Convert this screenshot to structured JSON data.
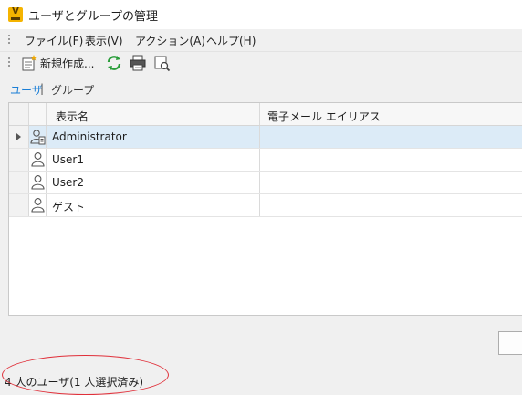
{
  "window": {
    "title": "ユーザとグループの管理",
    "app_icon_letter": "V"
  },
  "menu": {
    "items": [
      {
        "label": "ファイル(F)"
      },
      {
        "label": "表示(V)"
      },
      {
        "label": "アクション(A)"
      },
      {
        "label": "ヘルプ(H)"
      }
    ]
  },
  "toolbar": {
    "new_label": "新規作成...",
    "icons": [
      "new-document-icon",
      "refresh-icon",
      "print-icon",
      "print-preview-icon"
    ]
  },
  "tabs": {
    "users": "ユーザ",
    "separator": "|",
    "groups": "グループ"
  },
  "grid": {
    "columns": [
      "表示名",
      "電子メール エイリアス"
    ],
    "rows": [
      {
        "name": "Administrator",
        "email": "",
        "icon": "admin-user-icon",
        "selected": true
      },
      {
        "name": "User1",
        "email": "",
        "icon": "user-icon",
        "selected": false
      },
      {
        "name": "User2",
        "email": "",
        "icon": "user-icon",
        "selected": false
      },
      {
        "name": "ゲスト",
        "email": "",
        "icon": "user-icon",
        "selected": false
      }
    ]
  },
  "status": {
    "text": "4 人のユーザ(1 人選択済み)"
  },
  "colors": {
    "accent": "#1a7ed6",
    "selected_row": "#dcebf7",
    "annotation": "#e0303a",
    "app_icon": "#f5b400"
  }
}
